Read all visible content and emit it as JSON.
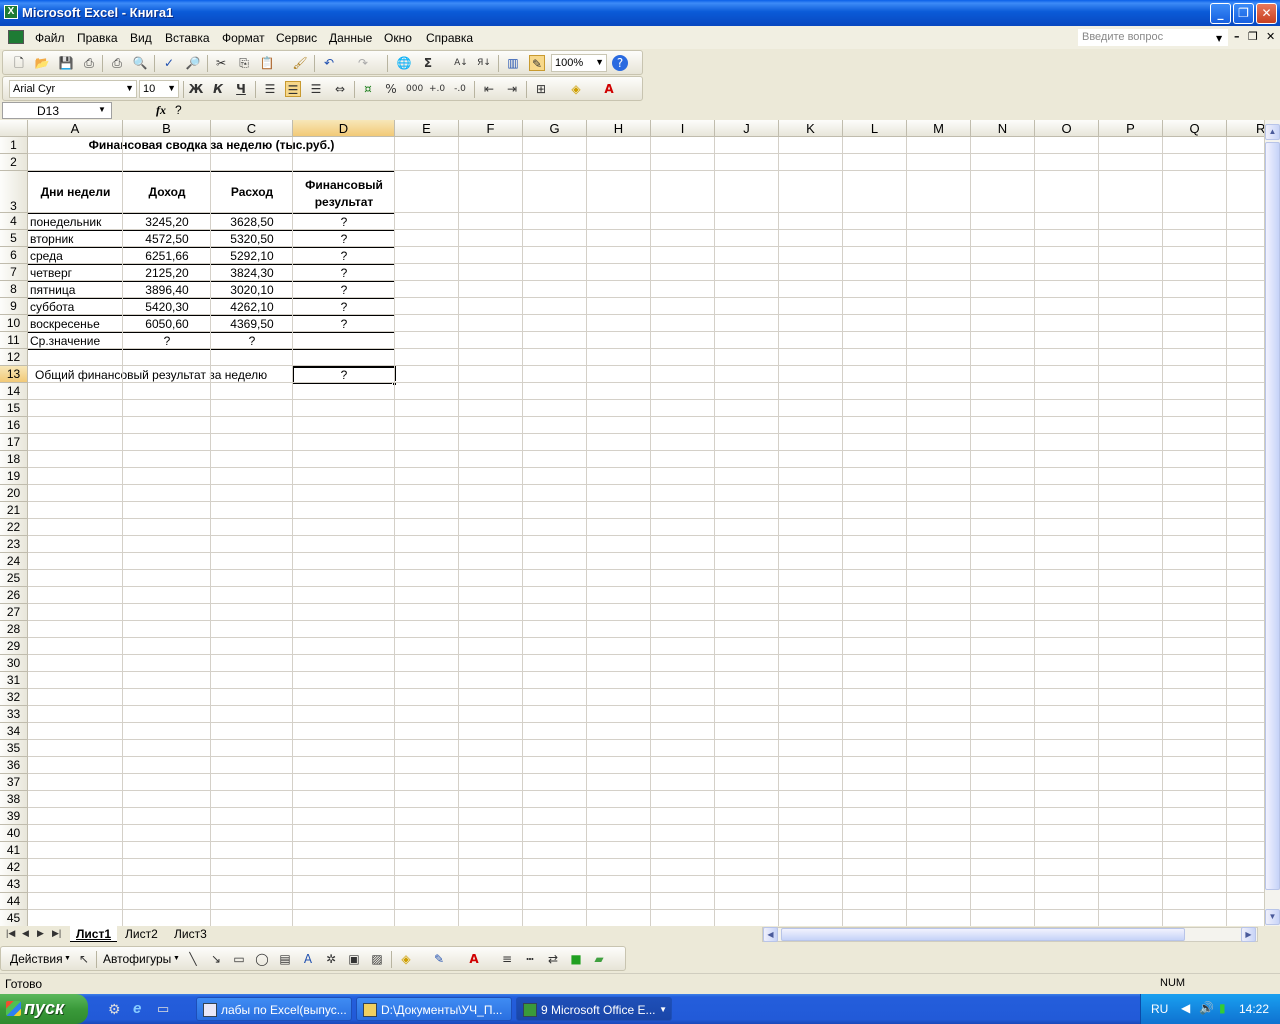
{
  "window": {
    "title": "Microsoft Excel - Книга1"
  },
  "menu": {
    "items": [
      "Файл",
      "Правка",
      "Вид",
      "Вставка",
      "Формат",
      "Сервис",
      "Данные",
      "Окно",
      "Справка"
    ],
    "ask_placeholder": "Введите вопрос"
  },
  "toolbar": {
    "zoom": "100%",
    "font_name": "Arial Cyr",
    "font_size": "10",
    "bold": "Ж",
    "italic": "К",
    "underline": "Ч",
    "percent": "%",
    "thousands": "000"
  },
  "formula_bar": {
    "name_box": "D13",
    "fx": "fx",
    "content": "?"
  },
  "grid": {
    "columns": [
      "A",
      "B",
      "C",
      "D",
      "E",
      "F",
      "G",
      "H",
      "I",
      "J",
      "K",
      "L",
      "M",
      "N",
      "O",
      "P",
      "Q",
      "R"
    ],
    "rows": [
      "1",
      "2",
      "3",
      "4",
      "5",
      "6",
      "7",
      "8",
      "9",
      "10",
      "11",
      "12",
      "13",
      "14",
      "15",
      "16",
      "17",
      "18",
      "19",
      "20",
      "21",
      "22",
      "23",
      "24",
      "25",
      "26",
      "27",
      "28",
      "29",
      "30",
      "31",
      "32",
      "33",
      "34",
      "35",
      "36",
      "37",
      "38",
      "39",
      "40",
      "41",
      "42",
      "43",
      "44",
      "45"
    ],
    "selected_cell": "D13"
  },
  "sheet": {
    "title": "Финансовая сводка за неделю (тыс.руб.)",
    "headers": {
      "days": "Дни недели",
      "income": "Доход",
      "expense": "Расход",
      "result_1": "Финансовый",
      "result_2": "результат"
    },
    "rows": [
      {
        "day": "понедельник",
        "income": "3245,20",
        "expense": "3628,50",
        "result": "?"
      },
      {
        "day": "вторник",
        "income": "4572,50",
        "expense": "5320,50",
        "result": "?"
      },
      {
        "day": "среда",
        "income": "6251,66",
        "expense": "5292,10",
        "result": "?"
      },
      {
        "day": "четверг",
        "income": "2125,20",
        "expense": "3824,30",
        "result": "?"
      },
      {
        "day": "пятница",
        "income": "3896,40",
        "expense": "3020,10",
        "result": "?"
      },
      {
        "day": "суббота",
        "income": "5420,30",
        "expense": "4262,10",
        "result": "?"
      },
      {
        "day": "воскресенье",
        "income": "6050,60",
        "expense": "4369,50",
        "result": "?"
      }
    ],
    "avg": {
      "label": "Ср.значение",
      "income": "?",
      "expense": "?"
    },
    "total": {
      "label": "Общий финансовый результат за неделю",
      "value": "?"
    }
  },
  "tabs": [
    "Лист1",
    "Лист2",
    "Лист3"
  ],
  "drawing": {
    "actions": "Действия",
    "autoshapes": "Автофигуры"
  },
  "status": {
    "ready": "Готово",
    "num": "NUM"
  },
  "taskbar": {
    "start": "пуск",
    "tasks": [
      "лабы по Excel(выпус...",
      "D:\\Документы\\УЧ_П...",
      "9 Microsoft Office E..."
    ],
    "lang": "RU",
    "time": "14:22"
  }
}
